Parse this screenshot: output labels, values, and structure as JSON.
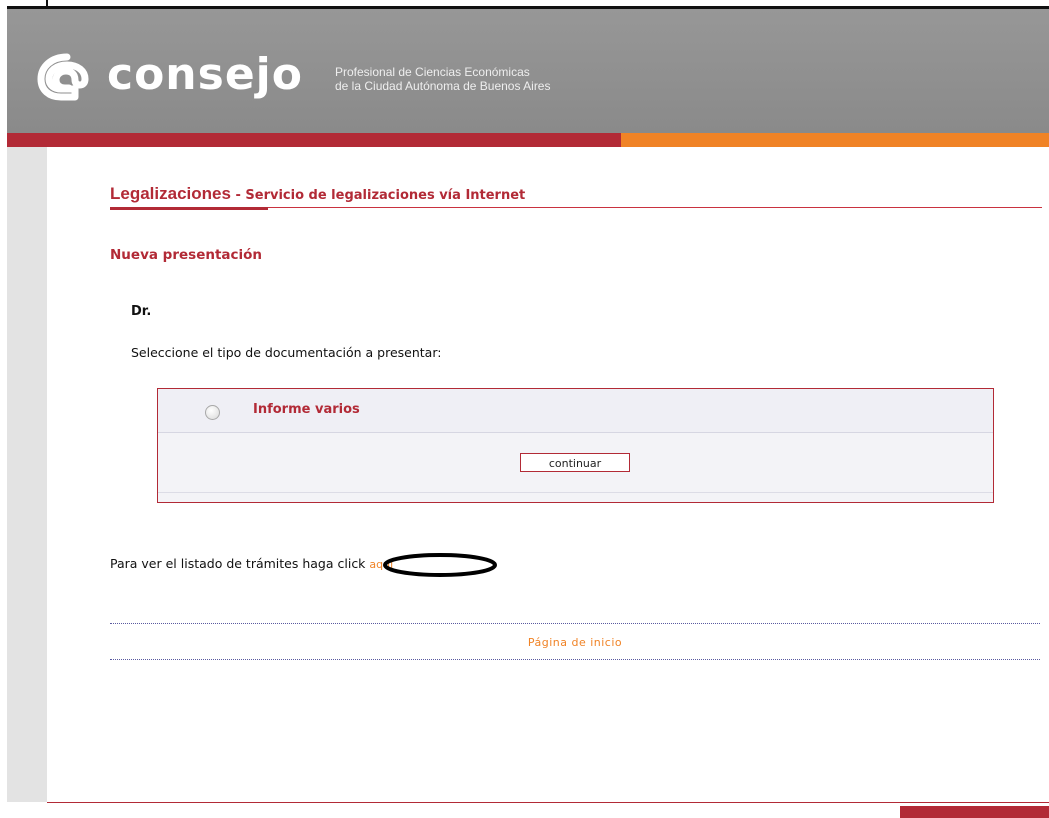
{
  "header": {
    "brand": "consejo",
    "subtitle_line1": "Profesional de Ciencias Económicas",
    "subtitle_line2": "de la Ciudad Autónoma de Buenos Aires"
  },
  "page": {
    "section_title": "Legalizaciones",
    "section_separator": " - ",
    "section_subtitle": "Servicio de legalizaciones vía Internet",
    "heading": "Nueva presentación",
    "doctor_label": "Dr.",
    "instruction": "Seleccione el tipo de documentación a presentar:"
  },
  "form": {
    "option_label": "Informe varios",
    "option_selected": false,
    "continue_label": "continuar"
  },
  "list_prompt": {
    "text": "Para ver el listado de trámites haga click ",
    "link": "aquí"
  },
  "footer": {
    "home_link": "Página de inicio"
  },
  "colors": {
    "brand_red": "#b22a36",
    "brand_orange": "#f08326",
    "header_gray": "#8e8e8e"
  }
}
